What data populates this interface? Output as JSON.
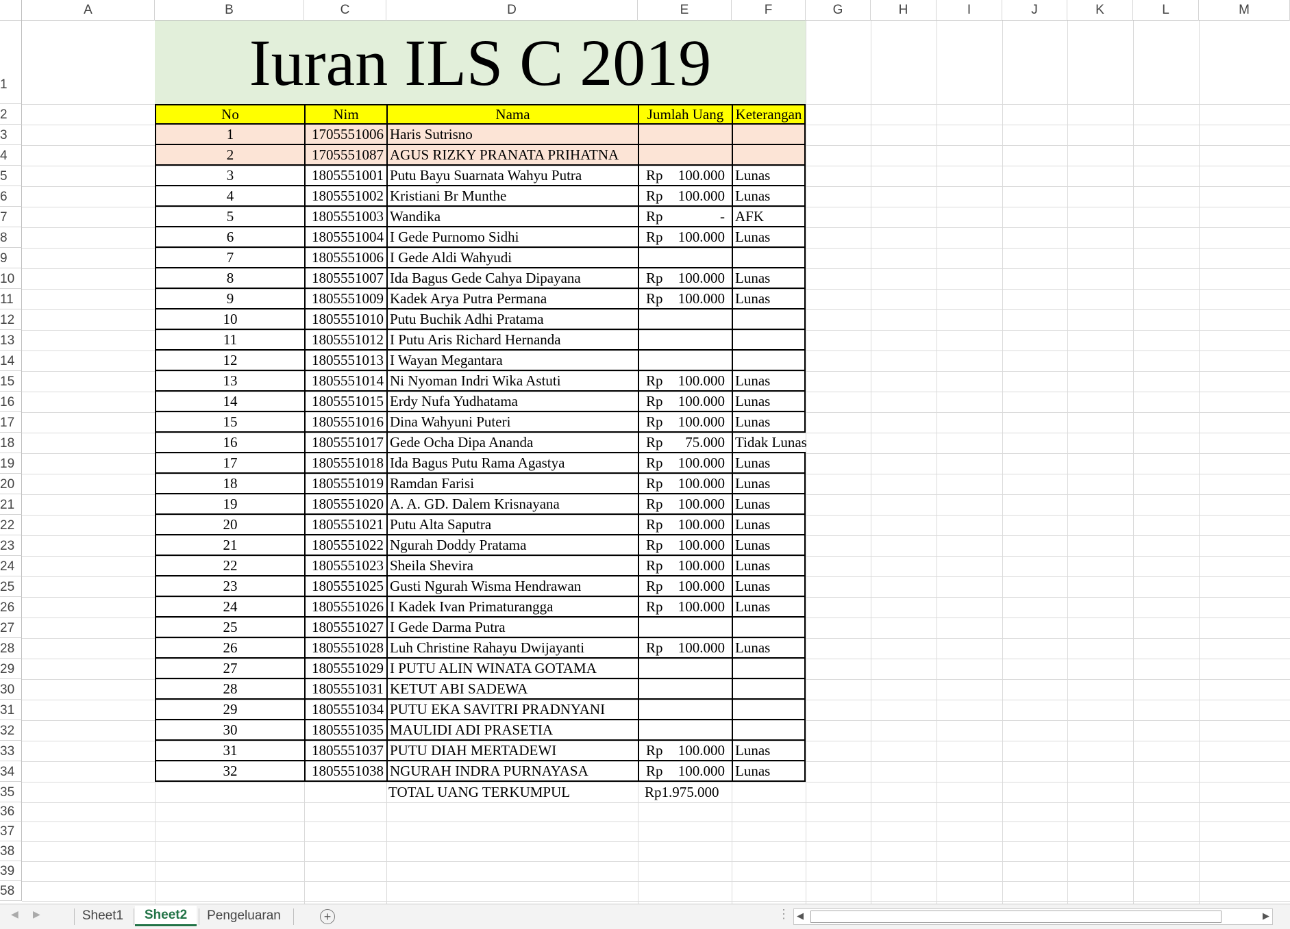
{
  "columns": [
    "A",
    "B",
    "C",
    "D",
    "E",
    "F",
    "G",
    "H",
    "I",
    "J",
    "K",
    "L",
    "M"
  ],
  "row_numbers": [
    "1",
    "2",
    "3",
    "4",
    "5",
    "6",
    "7",
    "8",
    "9",
    "10",
    "11",
    "12",
    "13",
    "14",
    "15",
    "16",
    "17",
    "18",
    "19",
    "20",
    "21",
    "22",
    "23",
    "24",
    "25",
    "26",
    "27",
    "28",
    "29",
    "30",
    "31",
    "32",
    "33",
    "34",
    "35",
    "36",
    "37",
    "38",
    "39",
    "58"
  ],
  "title": "Iuran ILS C 2019",
  "headers": {
    "no": "No",
    "nim": "Nim",
    "nama": "Nama",
    "jumlah": "Jumlah Uang",
    "ket": "Keterangan"
  },
  "currency": "Rp",
  "rows": [
    {
      "no": "1",
      "nim": "1705551006",
      "nama": "Haris Sutrisno",
      "amount": "",
      "ket": "",
      "highlight": true
    },
    {
      "no": "2",
      "nim": "1705551087",
      "nama": "AGUS RIZKY PRANATA PRIHATNA",
      "amount": "",
      "ket": "",
      "highlight": true
    },
    {
      "no": "3",
      "nim": "1805551001",
      "nama": "Putu Bayu Suarnata Wahyu Putra",
      "amount": "100.000",
      "ket": "Lunas"
    },
    {
      "no": "4",
      "nim": "1805551002",
      "nama": "Kristiani Br Munthe",
      "amount": "100.000",
      "ket": "Lunas"
    },
    {
      "no": "5",
      "nim": "1805551003",
      "nama": "Wandika",
      "amount": "-",
      "ket": "AFK"
    },
    {
      "no": "6",
      "nim": "1805551004",
      "nama": "I Gede Purnomo Sidhi",
      "amount": "100.000",
      "ket": "Lunas"
    },
    {
      "no": "7",
      "nim": "1805551006",
      "nama": "I Gede Aldi Wahyudi",
      "amount": "",
      "ket": ""
    },
    {
      "no": "8",
      "nim": "1805551007",
      "nama": "Ida Bagus Gede Cahya Dipayana",
      "amount": "100.000",
      "ket": "Lunas"
    },
    {
      "no": "9",
      "nim": "1805551009",
      "nama": "Kadek Arya Putra Permana",
      "amount": "100.000",
      "ket": "Lunas"
    },
    {
      "no": "10",
      "nim": "1805551010",
      "nama": "Putu Buchik Adhi Pratama",
      "amount": "",
      "ket": ""
    },
    {
      "no": "11",
      "nim": "1805551012",
      "nama": "I Putu Aris Richard Hernanda",
      "amount": "",
      "ket": ""
    },
    {
      "no": "12",
      "nim": "1805551013",
      "nama": "I Wayan Megantara",
      "amount": "",
      "ket": ""
    },
    {
      "no": "13",
      "nim": "1805551014",
      "nama": "Ni Nyoman Indri Wika Astuti",
      "amount": "100.000",
      "ket": "Lunas"
    },
    {
      "no": "14",
      "nim": "1805551015",
      "nama": "Erdy Nufa Yudhatama",
      "amount": "100.000",
      "ket": "Lunas"
    },
    {
      "no": "15",
      "nim": "1805551016",
      "nama": "Dina Wahyuni Puteri",
      "amount": "100.000",
      "ket": "Lunas"
    },
    {
      "no": "16",
      "nim": "1805551017",
      "nama": "Gede Ocha Dipa Ananda",
      "amount": "75.000",
      "ket": "Tidak Lunas"
    },
    {
      "no": "17",
      "nim": "1805551018",
      "nama": "Ida Bagus Putu Rama Agastya",
      "amount": "100.000",
      "ket": "Lunas"
    },
    {
      "no": "18",
      "nim": "1805551019",
      "nama": "Ramdan Farisi",
      "amount": "100.000",
      "ket": "Lunas"
    },
    {
      "no": "19",
      "nim": "1805551020",
      "nama": "A. A. GD. Dalem Krisnayana",
      "amount": "100.000",
      "ket": "Lunas"
    },
    {
      "no": "20",
      "nim": "1805551021",
      "nama": "Putu Alta Saputra",
      "amount": "100.000",
      "ket": "Lunas"
    },
    {
      "no": "21",
      "nim": "1805551022",
      "nama": "Ngurah Doddy Pratama",
      "amount": "100.000",
      "ket": "Lunas"
    },
    {
      "no": "22",
      "nim": "1805551023",
      "nama": "Sheila Shevira",
      "amount": "100.000",
      "ket": "Lunas"
    },
    {
      "no": "23",
      "nim": "1805551025",
      "nama": "Gusti Ngurah Wisma Hendrawan",
      "amount": "100.000",
      "ket": "Lunas"
    },
    {
      "no": "24",
      "nim": "1805551026",
      "nama": "I Kadek Ivan Primaturangga",
      "amount": "100.000",
      "ket": "Lunas"
    },
    {
      "no": "25",
      "nim": "1805551027",
      "nama": "I Gede Darma Putra",
      "amount": "",
      "ket": ""
    },
    {
      "no": "26",
      "nim": "1805551028",
      "nama": "Luh Christine Rahayu Dwijayanti",
      "amount": "100.000",
      "ket": "Lunas"
    },
    {
      "no": "27",
      "nim": "1805551029",
      "nama": "I PUTU ALIN WINATA GOTAMA",
      "amount": "",
      "ket": ""
    },
    {
      "no": "28",
      "nim": "1805551031",
      "nama": "KETUT ABI SADEWA",
      "amount": "",
      "ket": ""
    },
    {
      "no": "29",
      "nim": "1805551034",
      "nama": "PUTU EKA SAVITRI PRADNYANI",
      "amount": "",
      "ket": ""
    },
    {
      "no": "30",
      "nim": "1805551035",
      "nama": "MAULIDI ADI PRASETIA",
      "amount": "",
      "ket": ""
    },
    {
      "no": "31",
      "nim": "1805551037",
      "nama": "PUTU DIAH MERTADEWI",
      "amount": "100.000",
      "ket": "Lunas"
    },
    {
      "no": "32",
      "nim": "1805551038",
      "nama": "NGURAH INDRA PURNAYASA",
      "amount": "100.000",
      "ket": "Lunas"
    }
  ],
  "total": {
    "label": "TOTAL UANG TERKUMPUL",
    "value": "Rp1.975.000"
  },
  "tabs": [
    "Sheet1",
    "Sheet2",
    "Pengeluaran"
  ],
  "active_tab": "Sheet2",
  "colors": {
    "title_bg": "#e2efda",
    "header_bg": "#ffff00",
    "highlight_row": "#fce4d6",
    "active_tab": "#217346"
  }
}
